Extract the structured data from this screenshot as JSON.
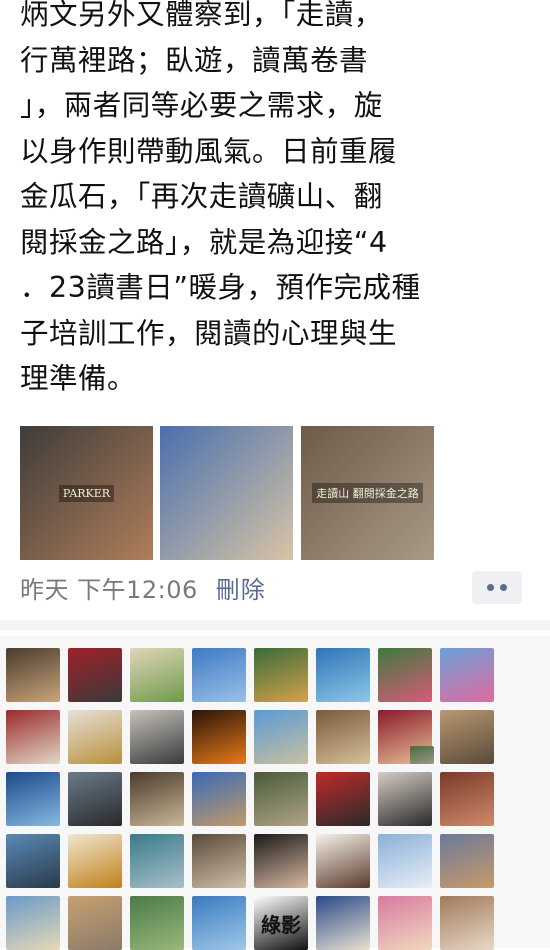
{
  "post": {
    "lines": [
      "炳文另外又體察到，「走讀，",
      "行萬裡路；臥遊，讀萬卷書",
      "」，兩者同等必要之需求，旋",
      "以身作則帶動風氣。日前重履",
      "金瓜石，「再次走讀礦山、翻",
      "閱採金之路」，就是為迎接“4",
      "．23讀書日”暖身，預作完成種",
      "子培訓工作，閱讀的心理與生",
      "理準備。"
    ]
  },
  "photos": [
    {
      "name": "pen-photo",
      "label": "PARKER",
      "colors": [
        "#3e3c3a",
        "#b07e5a"
      ]
    },
    {
      "name": "tv-studio-photo",
      "label": "",
      "colors": [
        "#4a6fae",
        "#d8c4a6"
      ]
    },
    {
      "name": "exhibition-photo",
      "label": "走讀山 翻閱採金之路",
      "colors": [
        "#6e5a48",
        "#a89a86"
      ]
    }
  ],
  "meta": {
    "time": "昨天 下午12:06",
    "delete_label": "刪除",
    "more_icon": "more-dots-icon"
  },
  "likes": {
    "avatars": [
      {
        "c": [
          "#4a3b2e",
          "#c9a47a"
        ],
        "t": ""
      },
      {
        "c": [
          "#a0202a",
          "#3a3a3a"
        ],
        "t": ""
      },
      {
        "c": [
          "#e0d6b8",
          "#6f9a4a"
        ],
        "t": ""
      },
      {
        "c": [
          "#3f7ac4",
          "#9ac0e6"
        ],
        "t": ""
      },
      {
        "c": [
          "#3b6b3a",
          "#d4a24a"
        ],
        "t": ""
      },
      {
        "c": [
          "#2f74b8",
          "#8cc8e6"
        ],
        "t": ""
      },
      {
        "c": [
          "#3e7a3e",
          "#d85a7a"
        ],
        "t": ""
      },
      {
        "c": [
          "#6aa0d8",
          "#e06aa0"
        ],
        "t": ""
      },
      {
        "c": [
          "#9a2a2a",
          "#e0d8c8"
        ],
        "t": ""
      },
      {
        "c": [
          "#e6e0d8",
          "#b8903a"
        ],
        "t": ""
      },
      {
        "c": [
          "#c6c2bc",
          "#3a3a3a"
        ],
        "t": ""
      },
      {
        "c": [
          "#2a1408",
          "#e87a1a"
        ],
        "t": ""
      },
      {
        "c": [
          "#5a9ad4",
          "#c8c0a0"
        ],
        "t": ""
      },
      {
        "c": [
          "#7a5a3a",
          "#d6c09a"
        ],
        "t": ""
      },
      {
        "c": [
          "#8a1a2a",
          "#e8c098"
        ],
        "t": ""
      },
      {
        "c": [
          "#4a6a3a",
          "#9a9a8a"
        ],
        "t": ""
      },
      {
        "c": [
          "#b89870",
          "#5a4a3a"
        ],
        "t": ""
      },
      {
        "c": [
          "#1a4a8a",
          "#88b8e0"
        ],
        "t": ""
      },
      {
        "c": [
          "#6a7a8a",
          "#2a2a2a"
        ],
        "t": ""
      },
      {
        "c": [
          "#4a3a2a",
          "#c8b898"
        ],
        "t": ""
      },
      {
        "c": [
          "#3a6ab8",
          "#c09a6a"
        ],
        "t": ""
      },
      {
        "c": [
          "#4a5a3a",
          "#b0a488"
        ],
        "t": ""
      },
      {
        "c": [
          "#c02a2a",
          "#2a2a2a"
        ],
        "t": ""
      },
      {
        "c": [
          "#d6ccc4",
          "#2a2a2a"
        ],
        "t": ""
      },
      {
        "c": [
          "#7a3a2a",
          "#d08a6a"
        ],
        "t": ""
      },
      {
        "c": [
          "#5a8ab8",
          "#2a3a4a"
        ],
        "t": ""
      },
      {
        "c": [
          "#f0e6d0",
          "#c0801a"
        ],
        "t": ""
      },
      {
        "c": [
          "#3a7a8a",
          "#a8c0c8"
        ],
        "t": ""
      },
      {
        "c": [
          "#5a4a3a",
          "#d0c0a8"
        ],
        "t": ""
      },
      {
        "c": [
          "#1a1a1a",
          "#d8b8a0"
        ],
        "t": ""
      },
      {
        "c": [
          "#f6f2ea",
          "#5a3a2a"
        ],
        "t": ""
      },
      {
        "c": [
          "#8ab0d8",
          "#e8eef6"
        ],
        "t": ""
      },
      {
        "c": [
          "#6a7a9a",
          "#c89a6a"
        ],
        "t": ""
      },
      {
        "c": [
          "#6a9ac8",
          "#e6d8b8"
        ],
        "t": ""
      },
      {
        "c": [
          "#c8a070",
          "#8a7a6a"
        ],
        "t": ""
      },
      {
        "c": [
          "#4a7a4a",
          "#9ab87a"
        ],
        "t": ""
      },
      {
        "c": [
          "#3a7ac0",
          "#a0c8e8"
        ],
        "t": ""
      },
      {
        "c": [
          "#ffffff",
          "#111111"
        ],
        "t": "綠影"
      },
      {
        "c": [
          "#2a4a8a",
          "#e8e0d0"
        ],
        "t": ""
      },
      {
        "c": [
          "#d87aa0",
          "#f2d8c0"
        ],
        "t": ""
      },
      {
        "c": [
          "#a07a5a",
          "#e8d8c8"
        ],
        "t": ""
      }
    ]
  }
}
